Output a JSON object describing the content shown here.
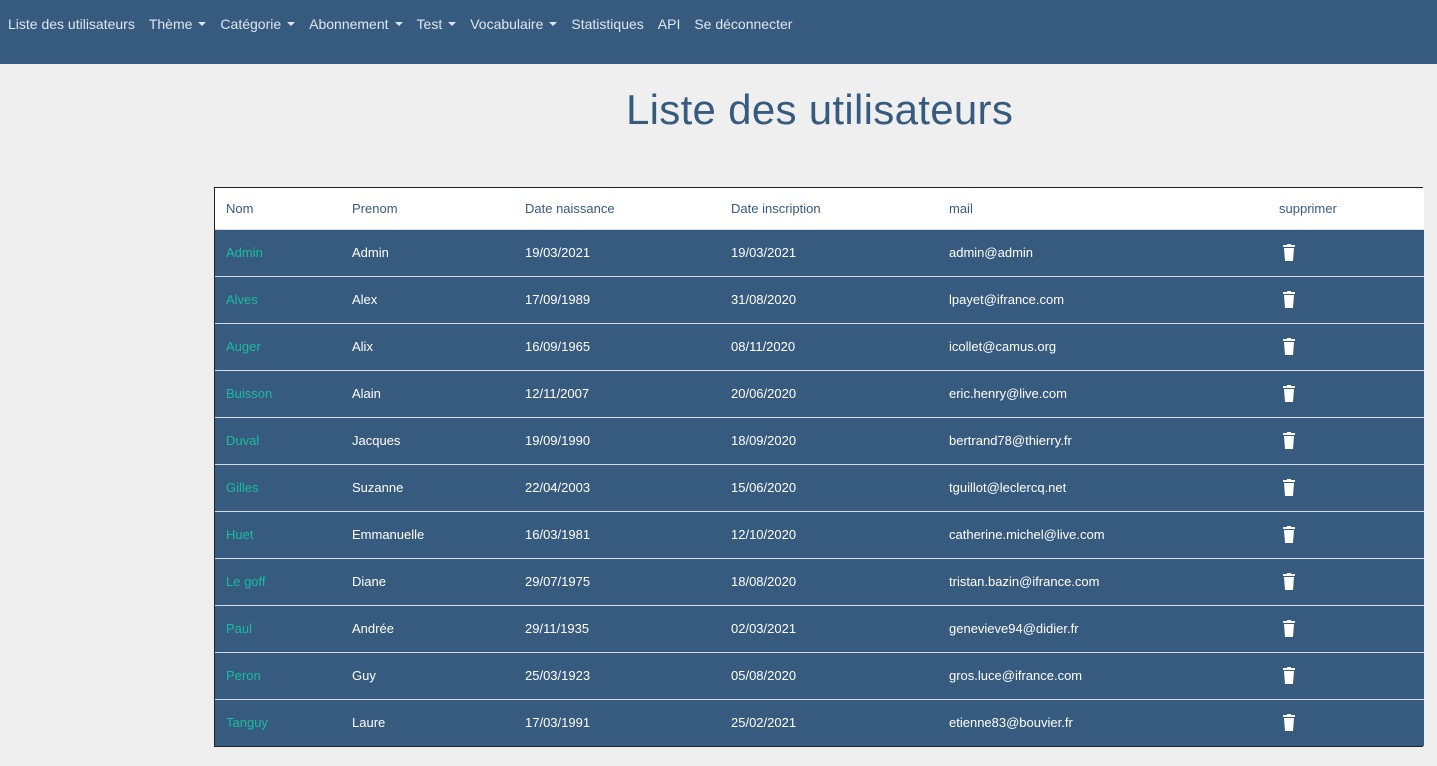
{
  "nav": {
    "items": [
      {
        "label": "Liste des utilisateurs",
        "dropdown": false
      },
      {
        "label": "Thème",
        "dropdown": true
      },
      {
        "label": "Catégorie",
        "dropdown": true
      },
      {
        "label": "Abonnement",
        "dropdown": true
      },
      {
        "label": "Test",
        "dropdown": true
      },
      {
        "label": "Vocabulaire",
        "dropdown": true
      },
      {
        "label": "Statistiques",
        "dropdown": false
      },
      {
        "label": "API",
        "dropdown": false
      },
      {
        "label": "Se déconnecter",
        "dropdown": false
      }
    ]
  },
  "page": {
    "title": "Liste des utilisateurs"
  },
  "table": {
    "headers": [
      "Nom",
      "Prenom",
      "Date naissance",
      "Date inscription",
      "mail",
      "supprimer"
    ],
    "rows": [
      {
        "nom": "Admin",
        "prenom": "Admin",
        "naissance": "19/03/2021",
        "inscription": "19/03/2021",
        "mail": "admin@admin"
      },
      {
        "nom": "Alves",
        "prenom": "Alex",
        "naissance": "17/09/1989",
        "inscription": "31/08/2020",
        "mail": "lpayet@ifrance.com"
      },
      {
        "nom": "Auger",
        "prenom": "Alix",
        "naissance": "16/09/1965",
        "inscription": "08/11/2020",
        "mail": "icollet@camus.org"
      },
      {
        "nom": "Buisson",
        "prenom": "Alain",
        "naissance": "12/11/2007",
        "inscription": "20/06/2020",
        "mail": "eric.henry@live.com"
      },
      {
        "nom": "Duval",
        "prenom": "Jacques",
        "naissance": "19/09/1990",
        "inscription": "18/09/2020",
        "mail": "bertrand78@thierry.fr"
      },
      {
        "nom": "Gilles",
        "prenom": "Suzanne",
        "naissance": "22/04/2003",
        "inscription": "15/06/2020",
        "mail": "tguillot@leclercq.net"
      },
      {
        "nom": "Huet",
        "prenom": "Emmanuelle",
        "naissance": "16/03/1981",
        "inscription": "12/10/2020",
        "mail": "catherine.michel@live.com"
      },
      {
        "nom": "Le goff",
        "prenom": "Diane",
        "naissance": "29/07/1975",
        "inscription": "18/08/2020",
        "mail": "tristan.bazin@ifrance.com"
      },
      {
        "nom": "Paul",
        "prenom": "Andrée",
        "naissance": "29/11/1935",
        "inscription": "02/03/2021",
        "mail": "genevieve94@didier.fr"
      },
      {
        "nom": "Peron",
        "prenom": "Guy",
        "naissance": "25/03/1923",
        "inscription": "05/08/2020",
        "mail": "gros.luce@ifrance.com"
      },
      {
        "nom": "Tanguy",
        "prenom": "Laure",
        "naissance": "17/03/1991",
        "inscription": "25/02/2021",
        "mail": "etienne83@bouvier.fr"
      }
    ]
  },
  "icons": {
    "delete": "trash-icon"
  },
  "colors": {
    "navbar": "#375a7f",
    "row_bg": "#375a7f",
    "link": "#1abc9c",
    "title": "#375a7f"
  }
}
